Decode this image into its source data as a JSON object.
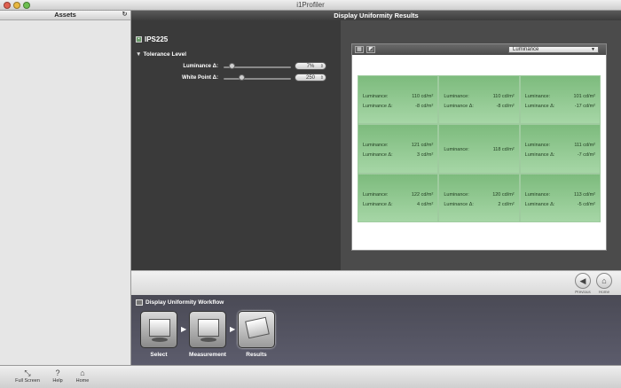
{
  "window": {
    "title": "i1Profiler"
  },
  "sidebar": {
    "title": "Assets"
  },
  "main": {
    "title": "Display Uniformity Results"
  },
  "device": {
    "name": "IPS225"
  },
  "tolerance": {
    "header": "Tolerance Level",
    "luminance_label": "Luminance Δ:",
    "luminance_value": "7%",
    "luminance_level": 0.08,
    "whitepoint_label": "White Point Δ:",
    "whitepoint_value": "250",
    "whitepoint_level": 0.25
  },
  "results": {
    "dropdown_value": "Luminance",
    "cells": [
      {
        "lum_label": "Luminance:",
        "lum": "110 cd/m²",
        "delta_label": "Luminance Δ:",
        "delta": "-8 cd/m²"
      },
      {
        "lum_label": "Luminance:",
        "lum": "110 cd/m²",
        "delta_label": "Luminance Δ:",
        "delta": "-8 cd/m²"
      },
      {
        "lum_label": "Luminance:",
        "lum": "101 cd/m²",
        "delta_label": "Luminance Δ:",
        "delta": "-17 cd/m²"
      },
      {
        "lum_label": "Luminance:",
        "lum": "121 cd/m²",
        "delta_label": "Luminance Δ:",
        "delta": "3 cd/m²"
      },
      {
        "lum_label": "Luminance:",
        "lum": "118 cd/m²"
      },
      {
        "lum_label": "Luminance:",
        "lum": "111 cd/m²",
        "delta_label": "Luminance Δ:",
        "delta": "-7 cd/m²"
      },
      {
        "lum_label": "Luminance:",
        "lum": "122 cd/m²",
        "delta_label": "Luminance Δ:",
        "delta": "4 cd/m²"
      },
      {
        "lum_label": "Luminance:",
        "lum": "120 cd/m²",
        "delta_label": "Luminance Δ:",
        "delta": "2 cd/m²"
      },
      {
        "lum_label": "Luminance:",
        "lum": "113 cd/m²",
        "delta_label": "Luminance Δ:",
        "delta": "-5 cd/m²"
      }
    ]
  },
  "nav": {
    "previous": "Previous",
    "home": "Home"
  },
  "workflow": {
    "title": "Display Uniformity Workflow",
    "steps": [
      "Select",
      "Measurement",
      "Results"
    ]
  },
  "bottom": {
    "fullscreen": "Full Screen",
    "help": "Help",
    "home": "Home"
  }
}
